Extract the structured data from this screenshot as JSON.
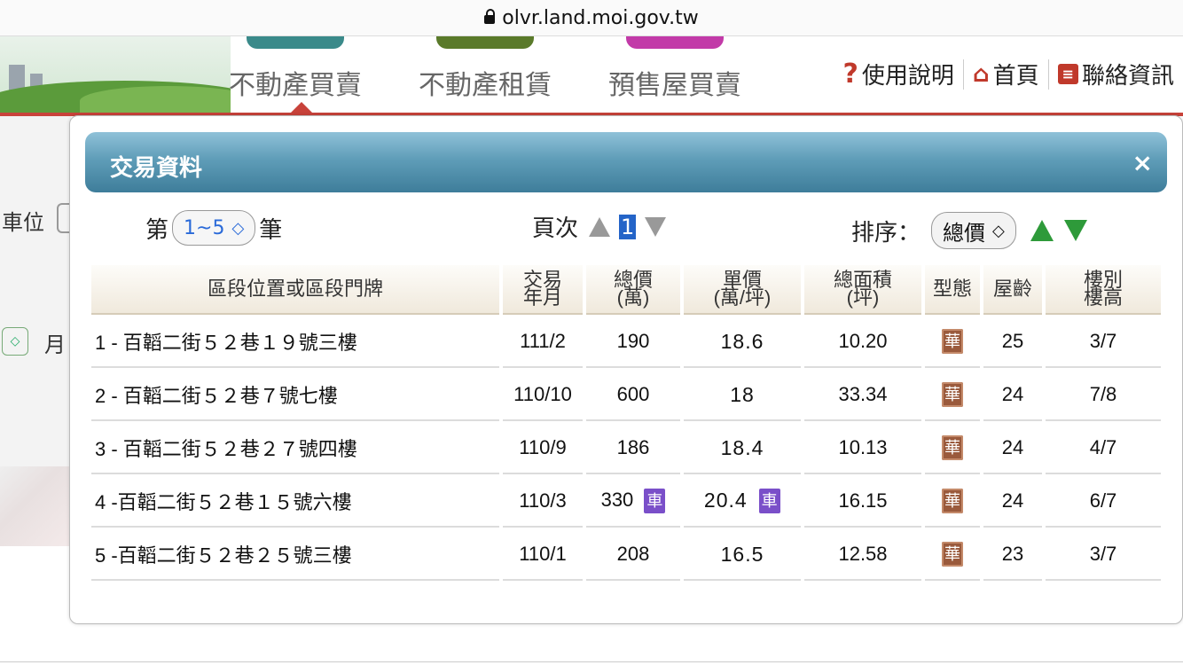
{
  "browser": {
    "url": "olvr.land.moi.gov.tw"
  },
  "header": {
    "tabs": [
      {
        "label": "不動產買賣",
        "color": "#3a8a8a"
      },
      {
        "label": "不動產租賃",
        "color": "#5a7a2a"
      },
      {
        "label": "預售屋買賣",
        "color": "#c23aa8"
      }
    ],
    "links": {
      "help": "使用說明",
      "home": "首頁",
      "contact": "聯絡資訊"
    }
  },
  "background": {
    "parking_label": "車位",
    "month_label": "月"
  },
  "dialog": {
    "title": "交易資料",
    "close": "×",
    "records_prefix": "第",
    "records_value": "1~5",
    "records_suffix": "筆",
    "page_label": "頁次",
    "page_value": "1",
    "sort_label": "排序：",
    "sort_value": "總價"
  },
  "table": {
    "headers": {
      "address": "區段位置或區段門牌",
      "date": [
        "交易",
        "年月"
      ],
      "total": [
        "總價",
        "(萬)"
      ],
      "unit": [
        "單價",
        "(萬/坪)"
      ],
      "area": [
        "總面積",
        "(坪)"
      ],
      "type": "型態",
      "age": "屋齡",
      "floor": [
        "樓別",
        "樓高"
      ]
    },
    "type_badge": "華",
    "car_badge": "車",
    "rows": [
      {
        "address": "1 - 百韜二街５２巷１９號三樓",
        "date": "111/2",
        "total": "190",
        "unit": "18.6",
        "area": "10.20",
        "age": "25",
        "floor": "3/7",
        "car": false
      },
      {
        "address": "2 - 百韜二街５２巷７號七樓",
        "date": "110/10",
        "total": "600",
        "unit": "18",
        "area": "33.34",
        "age": "24",
        "floor": "7/8",
        "car": false
      },
      {
        "address": "3 - 百韜二街５２巷２７號四樓",
        "date": "110/9",
        "total": "186",
        "unit": "18.4",
        "area": "10.13",
        "age": "24",
        "floor": "4/7",
        "car": false
      },
      {
        "address": "4 -百韜二街５２巷１５號六樓",
        "date": "110/3",
        "total": "330",
        "unit": "20.4",
        "area": "16.15",
        "age": "24",
        "floor": "6/7",
        "car": true
      },
      {
        "address": "5 -百韜二街５２巷２５號三樓",
        "date": "110/1",
        "total": "208",
        "unit": "16.5",
        "area": "12.58",
        "age": "23",
        "floor": "3/7",
        "car": false
      }
    ]
  }
}
